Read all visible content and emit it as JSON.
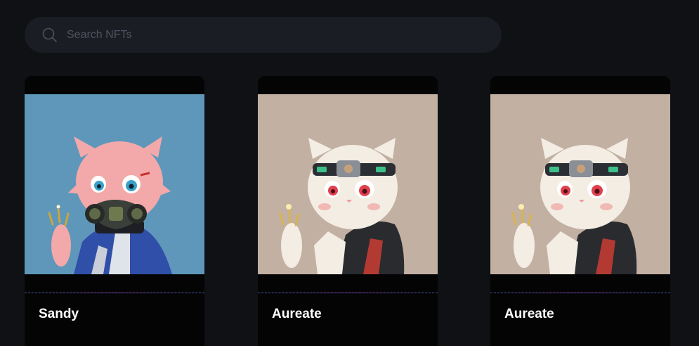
{
  "search": {
    "placeholder": "Search NFTs",
    "icon": "search-icon"
  },
  "cards": [
    {
      "name": "Sandy",
      "bg": "#5f97bb",
      "fur": "#f3a9a9",
      "eye": "#3aa0c8",
      "accessory": "gas-mask"
    },
    {
      "name": "Aureate",
      "bg": "#c2b0a3",
      "fur": "#f3ede4",
      "eye": "#e0404d",
      "accessory": "goggles"
    },
    {
      "name": "Aureate",
      "bg": "#c2b0a3",
      "fur": "#f3ede4",
      "eye": "#e0404d",
      "accessory": "goggles"
    }
  ]
}
